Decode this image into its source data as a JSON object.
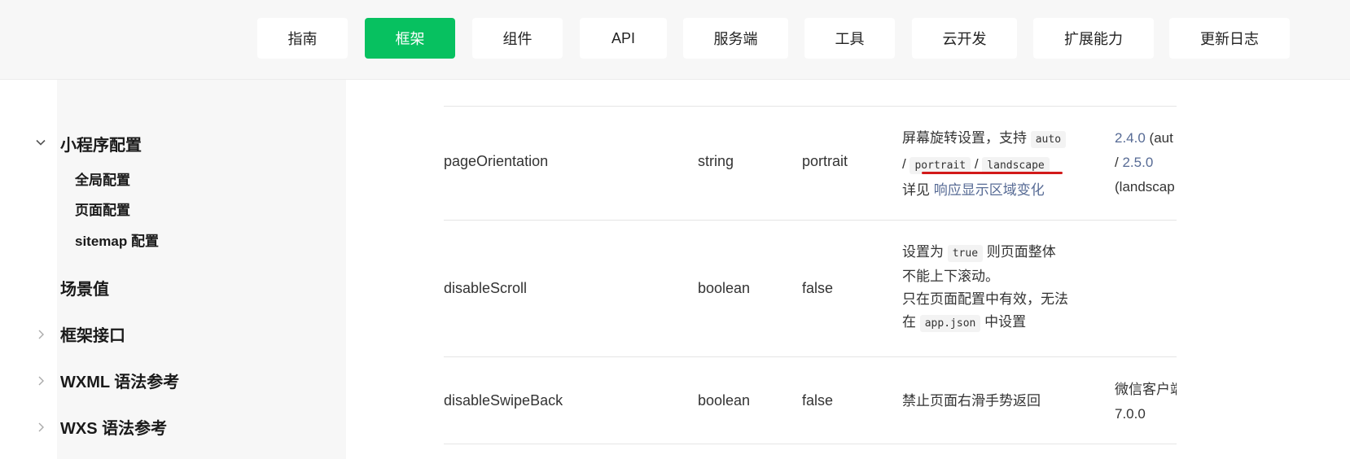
{
  "nav": {
    "items": [
      "指南",
      "框架",
      "组件",
      "API",
      "服务端",
      "工具",
      "云开发",
      "扩展能力",
      "更新日志"
    ],
    "active_index": 1,
    "active_color": "#07c160"
  },
  "sidebar": {
    "section_title": "小程序配置",
    "sub_items": [
      "全局配置",
      "页面配置",
      "sitemap 配置"
    ],
    "items": [
      "场景值",
      "框架接口",
      "WXML 语法参考",
      "WXS 语法参考"
    ]
  },
  "table": {
    "rows": [
      {
        "name": "pageOrientation",
        "type": "string",
        "default": "portrait",
        "desc_prefix": "屏幕旋转设置，支持",
        "code_auto": "auto",
        "slash": "/",
        "code_portrait": "portrait",
        "code_landscape": "landscape",
        "see_prefix": "详见",
        "see_link": "响应显示区域变化",
        "version_1": "2.4.0",
        "version_1_suffix": "(aut",
        "version_2": "2.5.0",
        "version_2_suffix": "(landscap"
      },
      {
        "name": "disableScroll",
        "type": "boolean",
        "default": "false",
        "desc_prefix": "设置为",
        "code_true": "true",
        "desc_suffix": "则页面整体",
        "desc_line2": "不能上下滚动。",
        "desc_line3": "只在页面配置中有效，无法",
        "desc_line4_prefix": "在",
        "code_appjson": "app.json",
        "desc_line4_suffix": "中设置"
      },
      {
        "name": "disableSwipeBack",
        "type": "boolean",
        "default": "false",
        "desc": "禁止页面右滑手势返回",
        "version_line1": "微信客户端",
        "version_line2": "7.0.0"
      }
    ]
  },
  "colors": {
    "link": "#576b95",
    "underline": "#d21a1a"
  }
}
